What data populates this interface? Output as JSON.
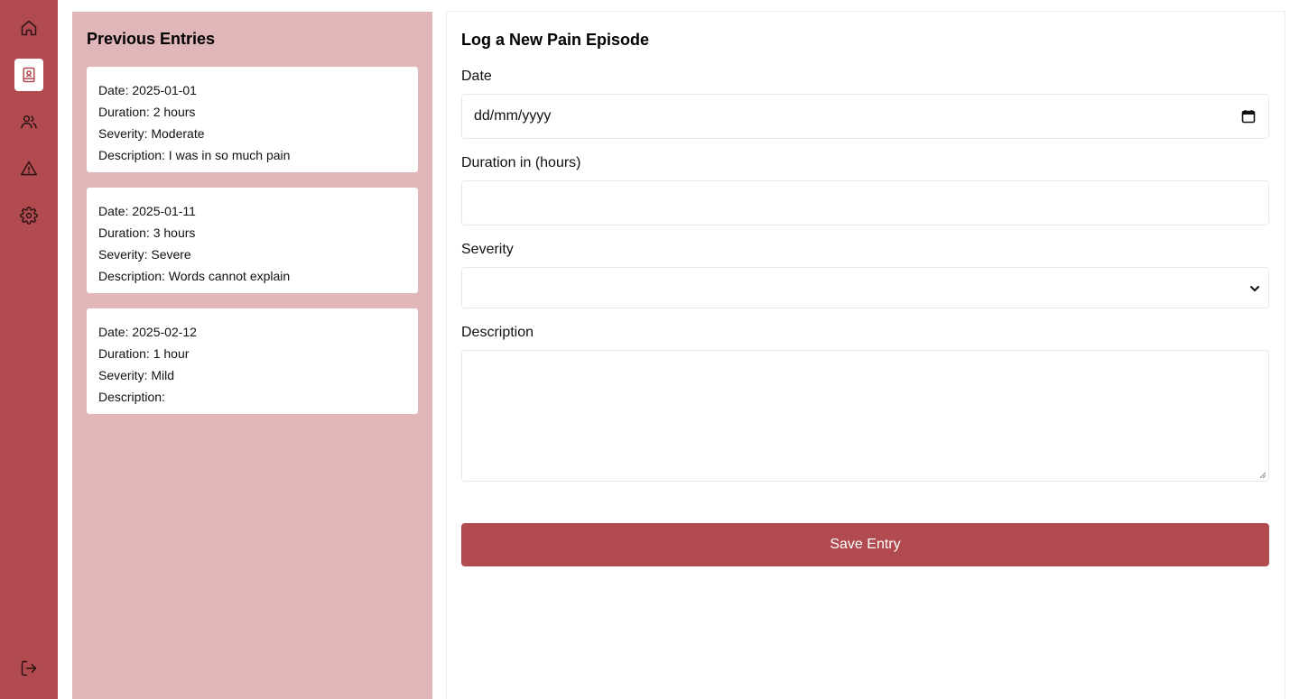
{
  "sidebar": {
    "items": [
      {
        "icon": "home-icon"
      },
      {
        "icon": "journal-icon",
        "active": true
      },
      {
        "icon": "users-icon"
      },
      {
        "icon": "warning-icon"
      },
      {
        "icon": "settings-icon"
      }
    ],
    "logout_icon": "logout-icon"
  },
  "entries": {
    "title": "Previous Entries",
    "items": [
      {
        "date": "Date: 2025-01-01",
        "duration": "Duration: 2 hours",
        "severity": "Severity: Moderate",
        "description": "Description: I was in so much pain"
      },
      {
        "date": "Date: 2025-01-11",
        "duration": "Duration: 3 hours",
        "severity": "Severity: Severe",
        "description": "Description: Words cannot explain"
      },
      {
        "date": "Date: 2025-02-12",
        "duration": "Duration: 1 hour",
        "severity": "Severity: Mild",
        "description": "Description:"
      }
    ]
  },
  "form": {
    "title": "Log a New Pain Episode",
    "date_label": "Date",
    "date_placeholder": "dd/mm/yyyy",
    "duration_label": "Duration in (hours)",
    "duration_value": "",
    "severity_label": "Severity",
    "severity_value": "",
    "description_label": "Description",
    "description_value": "",
    "save_label": "Save Entry"
  },
  "colors": {
    "accent": "#b14b4f",
    "panel": "#e0b6b8"
  }
}
